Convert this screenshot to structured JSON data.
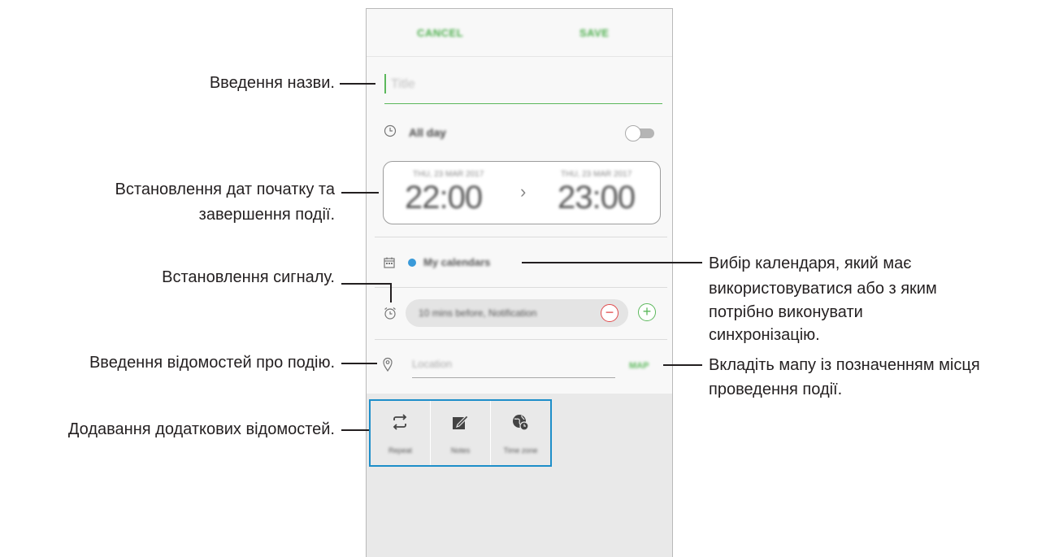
{
  "app": {
    "action_bar": {
      "cancel_label": "CANCEL",
      "save_label": "SAVE"
    },
    "title_field": {
      "placeholder": "Title"
    },
    "all_day": {
      "label": "All day",
      "enabled": false
    },
    "dates": {
      "start_date": "THU, 23 MAR 2017",
      "start_time": "22:00",
      "end_date": "THU, 23 MAR 2017",
      "end_time": "23:00",
      "arrow": "›"
    },
    "calendar": {
      "label": "My calendars",
      "color": "#3a9ad9"
    },
    "alarm": {
      "label": "10 mins before, Notification",
      "remove": "−",
      "add": "+"
    },
    "location": {
      "placeholder": "Location",
      "map_label": "MAP"
    },
    "extras": [
      {
        "label": "Repeat",
        "icon": "repeat-icon"
      },
      {
        "label": "Notes",
        "icon": "notes-icon"
      },
      {
        "label": "Time zone",
        "icon": "time-zone-icon"
      }
    ],
    "accent_color": "#5cb85c",
    "highlight_color": "#1d8ec9"
  },
  "annotations": {
    "title": "Введення назви.",
    "dates_line1": "Встановлення дат початку та",
    "dates_line2": "завершення події.",
    "alarm": "Встановлення сигналу.",
    "details": "Введення відомостей про подію.",
    "extras": "Додавання додаткових відомостей.",
    "calendar_line1": "Вибір календаря, який має",
    "calendar_line2": "використовуватися або з яким",
    "calendar_line3": "потрібно виконувати",
    "calendar_line4": "синхронізацію.",
    "map_line1": "Вкладіть мапу із позначенням місця",
    "map_line2": "проведення події."
  }
}
